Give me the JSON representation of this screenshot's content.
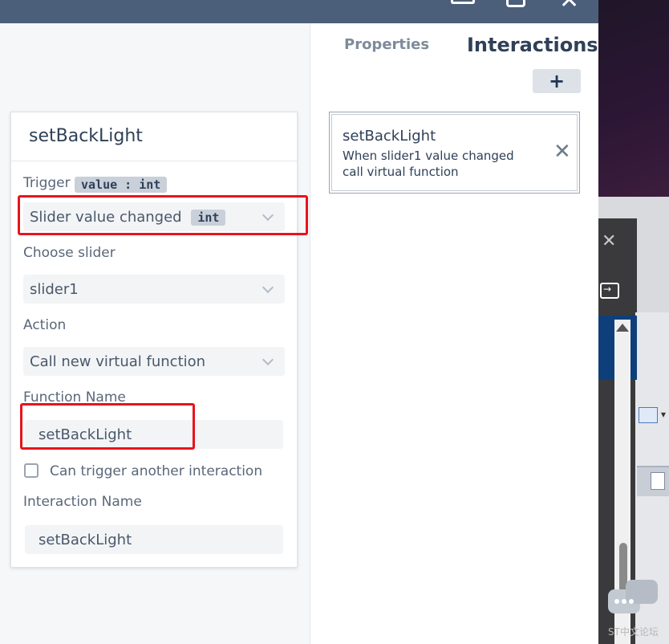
{
  "tabs": {
    "properties": "Properties",
    "interactions": "Interactions"
  },
  "add_button": "+",
  "interaction_card": {
    "title": "setBackLight",
    "line1": "When slider1 value changed",
    "line2": "call virtual function",
    "close": "✕"
  },
  "editor": {
    "title": "setBackLight",
    "trigger": {
      "label": "Trigger",
      "badge": "value : int",
      "value": "Slider value changed",
      "value_badge": "int"
    },
    "choose_slider": {
      "label": "Choose slider",
      "value": "slider1"
    },
    "action": {
      "label": "Action",
      "value": "Call new virtual function"
    },
    "function_name": {
      "label": "Function Name",
      "value": "setBackLight"
    },
    "can_trigger": {
      "label": "Can trigger another interaction",
      "checked": false
    },
    "interaction_name": {
      "label": "Interaction Name",
      "value": "setBackLight"
    }
  },
  "window": {
    "close": "✕"
  },
  "sub_window": {
    "close": "✕"
  },
  "watermark": "ST中文论坛",
  "colors": {
    "titlebar": "#4b5f7b",
    "highlight": "#e8141c",
    "text_dark": "#2f4058"
  },
  "icons": [
    "minimize-icon",
    "maximize-icon",
    "close-icon",
    "plus-icon",
    "chevron-down-icon",
    "checkbox-icon",
    "chat-icon",
    "scroll-up-icon",
    "document-icon"
  ]
}
